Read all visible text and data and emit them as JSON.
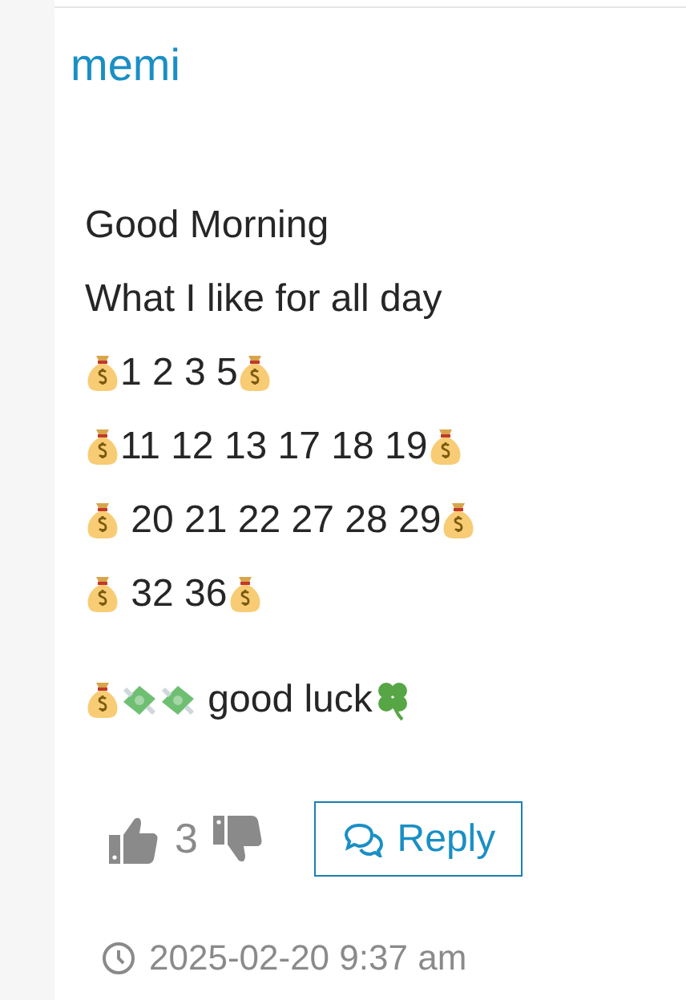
{
  "comment": {
    "author": "memi",
    "paragraphs": [
      {
        "lines": [
          {
            "parts": [
              {
                "kind": "text",
                "text": "Good Morning"
              }
            ]
          },
          {
            "parts": [
              {
                "kind": "text",
                "text": "What I like for all day"
              }
            ]
          },
          {
            "parts": [
              {
                "kind": "bag"
              },
              {
                "kind": "text",
                "text": "1 2 3 5"
              },
              {
                "kind": "bag"
              }
            ]
          },
          {
            "parts": [
              {
                "kind": "bag"
              },
              {
                "kind": "text",
                "text": "11 12 13 17 18 19"
              },
              {
                "kind": "bag"
              }
            ]
          },
          {
            "parts": [
              {
                "kind": "bag"
              },
              {
                "kind": "text",
                "text": " 20 21 22 27 28 29"
              },
              {
                "kind": "bag"
              }
            ]
          },
          {
            "parts": [
              {
                "kind": "bag"
              },
              {
                "kind": "text",
                "text": " 32 36"
              },
              {
                "kind": "bag"
              }
            ]
          }
        ]
      },
      {
        "lines": [
          {
            "parts": [
              {
                "kind": "bag"
              },
              {
                "kind": "cash"
              },
              {
                "kind": "cash"
              },
              {
                "kind": "text",
                "text": " good luck"
              },
              {
                "kind": "clover"
              }
            ]
          }
        ]
      }
    ],
    "likes": "3",
    "reply": "Reply",
    "timestamp": "2025-02-20 9:37 am"
  }
}
